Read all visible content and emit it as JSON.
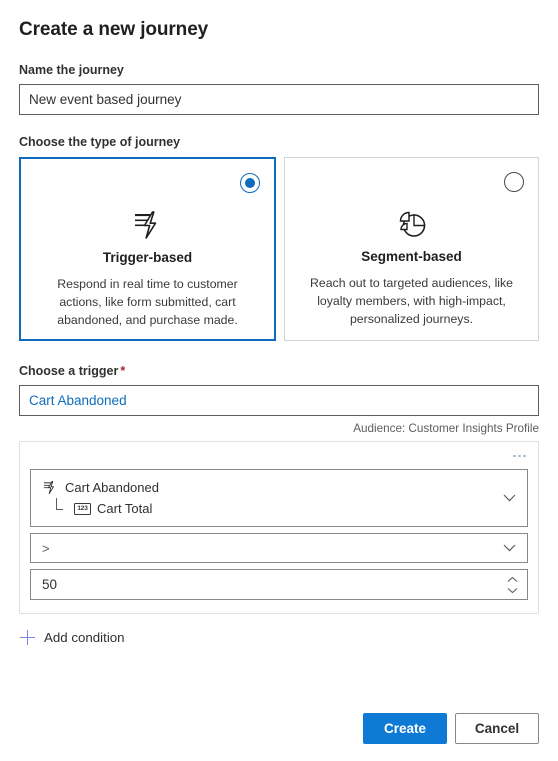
{
  "dialog": {
    "title": "Create a new journey"
  },
  "name_field": {
    "label": "Name the journey",
    "value": "New event based journey",
    "placeholder": "Name the journey"
  },
  "journey_type": {
    "label": "Choose the type of journey",
    "options": [
      {
        "id": "trigger-based",
        "title": "Trigger-based",
        "description": "Respond in real time to customer actions, like form submitted, cart abandoned, and purchase made.",
        "icon": "trigger-bolt-icon",
        "selected": true
      },
      {
        "id": "segment-based",
        "title": "Segment-based",
        "description": "Reach out to targeted audiences, like loyalty members, with high-impact, personalized journeys.",
        "icon": "pie-chart-icon",
        "selected": false
      }
    ]
  },
  "trigger": {
    "label": "Choose a trigger",
    "required_marker": "*",
    "value": "Cart Abandoned",
    "placeholder": "Choose a trigger",
    "audience_note": "Audience: Customer Insights Profile"
  },
  "condition": {
    "menu_icon": "ellipsis-icon",
    "attribute": {
      "root_label": "Cart Abandoned",
      "root_icon": "trigger-bolt-icon",
      "child_label": "Cart Total",
      "child_icon": "number-field-icon",
      "chevron_icon": "chevron-down-icon"
    },
    "operator": {
      "value": ">",
      "chevron_icon": "chevron-down-icon"
    },
    "value_field": {
      "value": "50",
      "increment_icon": "chevron-up-icon",
      "decrement_icon": "chevron-down-icon"
    },
    "add_condition_label": "Add condition",
    "add_condition_icon": "plus-icon"
  },
  "footer": {
    "create_label": "Create",
    "cancel_label": "Cancel"
  },
  "colors": {
    "accent": "#0f6cbd",
    "primary_button": "#0f7ad6",
    "required": "#a4262c",
    "link": "#0f6cbd",
    "plus": "#7b83eb"
  }
}
